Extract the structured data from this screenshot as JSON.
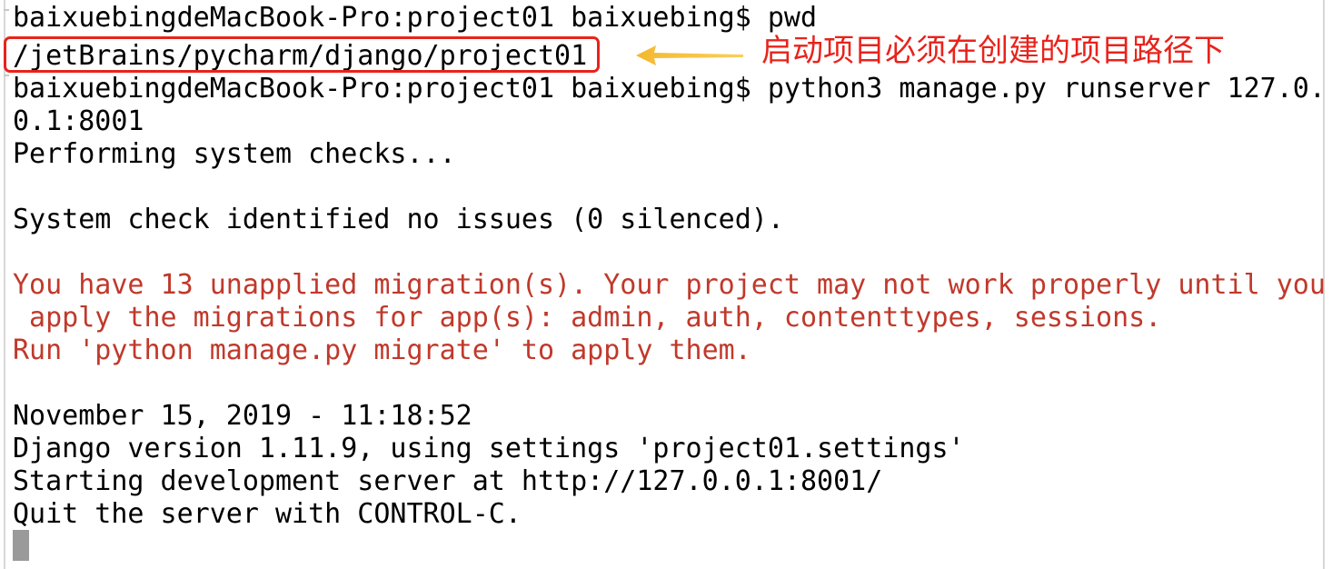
{
  "terminal": {
    "lines": [
      {
        "text": "baixuebingdeMacBook-Pro:project01 baixuebing$ pwd",
        "kind": "normal"
      },
      {
        "text": "/jetBrains/pycharm/django/project01",
        "kind": "normal"
      },
      {
        "text": "baixuebingdeMacBook-Pro:project01 baixuebing$ python3 manage.py runserver 127.0.",
        "kind": "normal"
      },
      {
        "text": "0.1:8001",
        "kind": "normal"
      },
      {
        "text": "Performing system checks...",
        "kind": "normal"
      },
      {
        "text": "",
        "kind": "blank"
      },
      {
        "text": "System check identified no issues (0 silenced).",
        "kind": "normal"
      },
      {
        "text": "",
        "kind": "blank"
      },
      {
        "text": "You have 13 unapplied migration(s). Your project may not work properly until you",
        "kind": "warn"
      },
      {
        "text": " apply the migrations for app(s): admin, auth, contenttypes, sessions.",
        "kind": "warn"
      },
      {
        "text": "Run 'python manage.py migrate' to apply them.",
        "kind": "warn"
      },
      {
        "text": "",
        "kind": "blank"
      },
      {
        "text": "November 15, 2019 - 11:18:52",
        "kind": "normal"
      },
      {
        "text": "Django version 1.11.9, using settings 'project01.settings'",
        "kind": "normal"
      },
      {
        "text": "Starting development server at http://127.0.0.1:8001/",
        "kind": "normal"
      },
      {
        "text": "Quit the server with CONTROL-C.",
        "kind": "normal"
      }
    ]
  },
  "annotation": {
    "note": "启动项目必须在创建的项目路径下",
    "color": "#e8231b",
    "arrow_color": "#f5b82e"
  },
  "colors": {
    "text": "#000000",
    "warning_text": "#c0392b",
    "background": "#ffffff",
    "cursor": "#9a9a9a"
  }
}
